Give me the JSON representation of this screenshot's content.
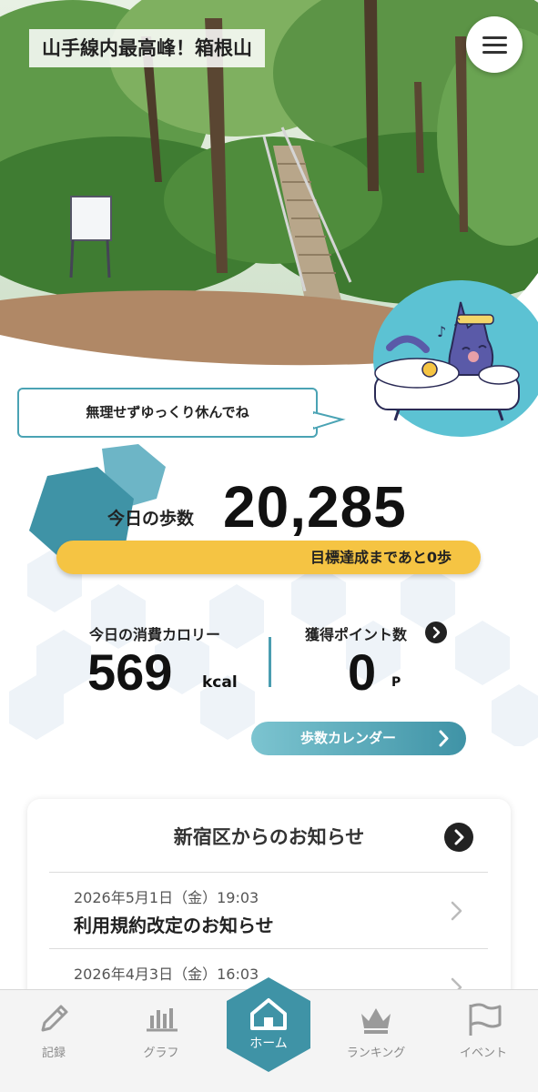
{
  "header": {
    "location_title": "山手線内最高峰！箱根山"
  },
  "message": {
    "bubble_text": "無理せずゆっくり休んでね"
  },
  "steps": {
    "label": "今日の歩数",
    "value": "20,285",
    "goal_text": "目標達成まであと0歩"
  },
  "calories": {
    "label": "今日の消費カロリー",
    "value": "569",
    "unit": "kcal"
  },
  "points": {
    "label": "獲得ポイント数",
    "value": "0",
    "unit": "P"
  },
  "calendar_button": {
    "label": "歩数カレンダー"
  },
  "news": {
    "title": "新宿区からのお知らせ",
    "items": [
      {
        "date": "2026年5月1日（金）19:03",
        "text": "利用規約改定のお知らせ"
      },
      {
        "date": "2026年4月3日（金）16:03",
        "text": ""
      }
    ]
  },
  "nav": {
    "items": [
      {
        "label": "記録",
        "icon": "pencil-icon"
      },
      {
        "label": "グラフ",
        "icon": "bar-chart-icon"
      },
      {
        "label": "ホーム",
        "icon": "home-icon"
      },
      {
        "label": "ランキング",
        "icon": "crown-icon"
      },
      {
        "label": "イベント",
        "icon": "flag-icon"
      }
    ]
  },
  "colors": {
    "accent_teal": "#4aa3b4",
    "goal_yellow": "#f5c443",
    "nav_home": "#3f93a6"
  }
}
